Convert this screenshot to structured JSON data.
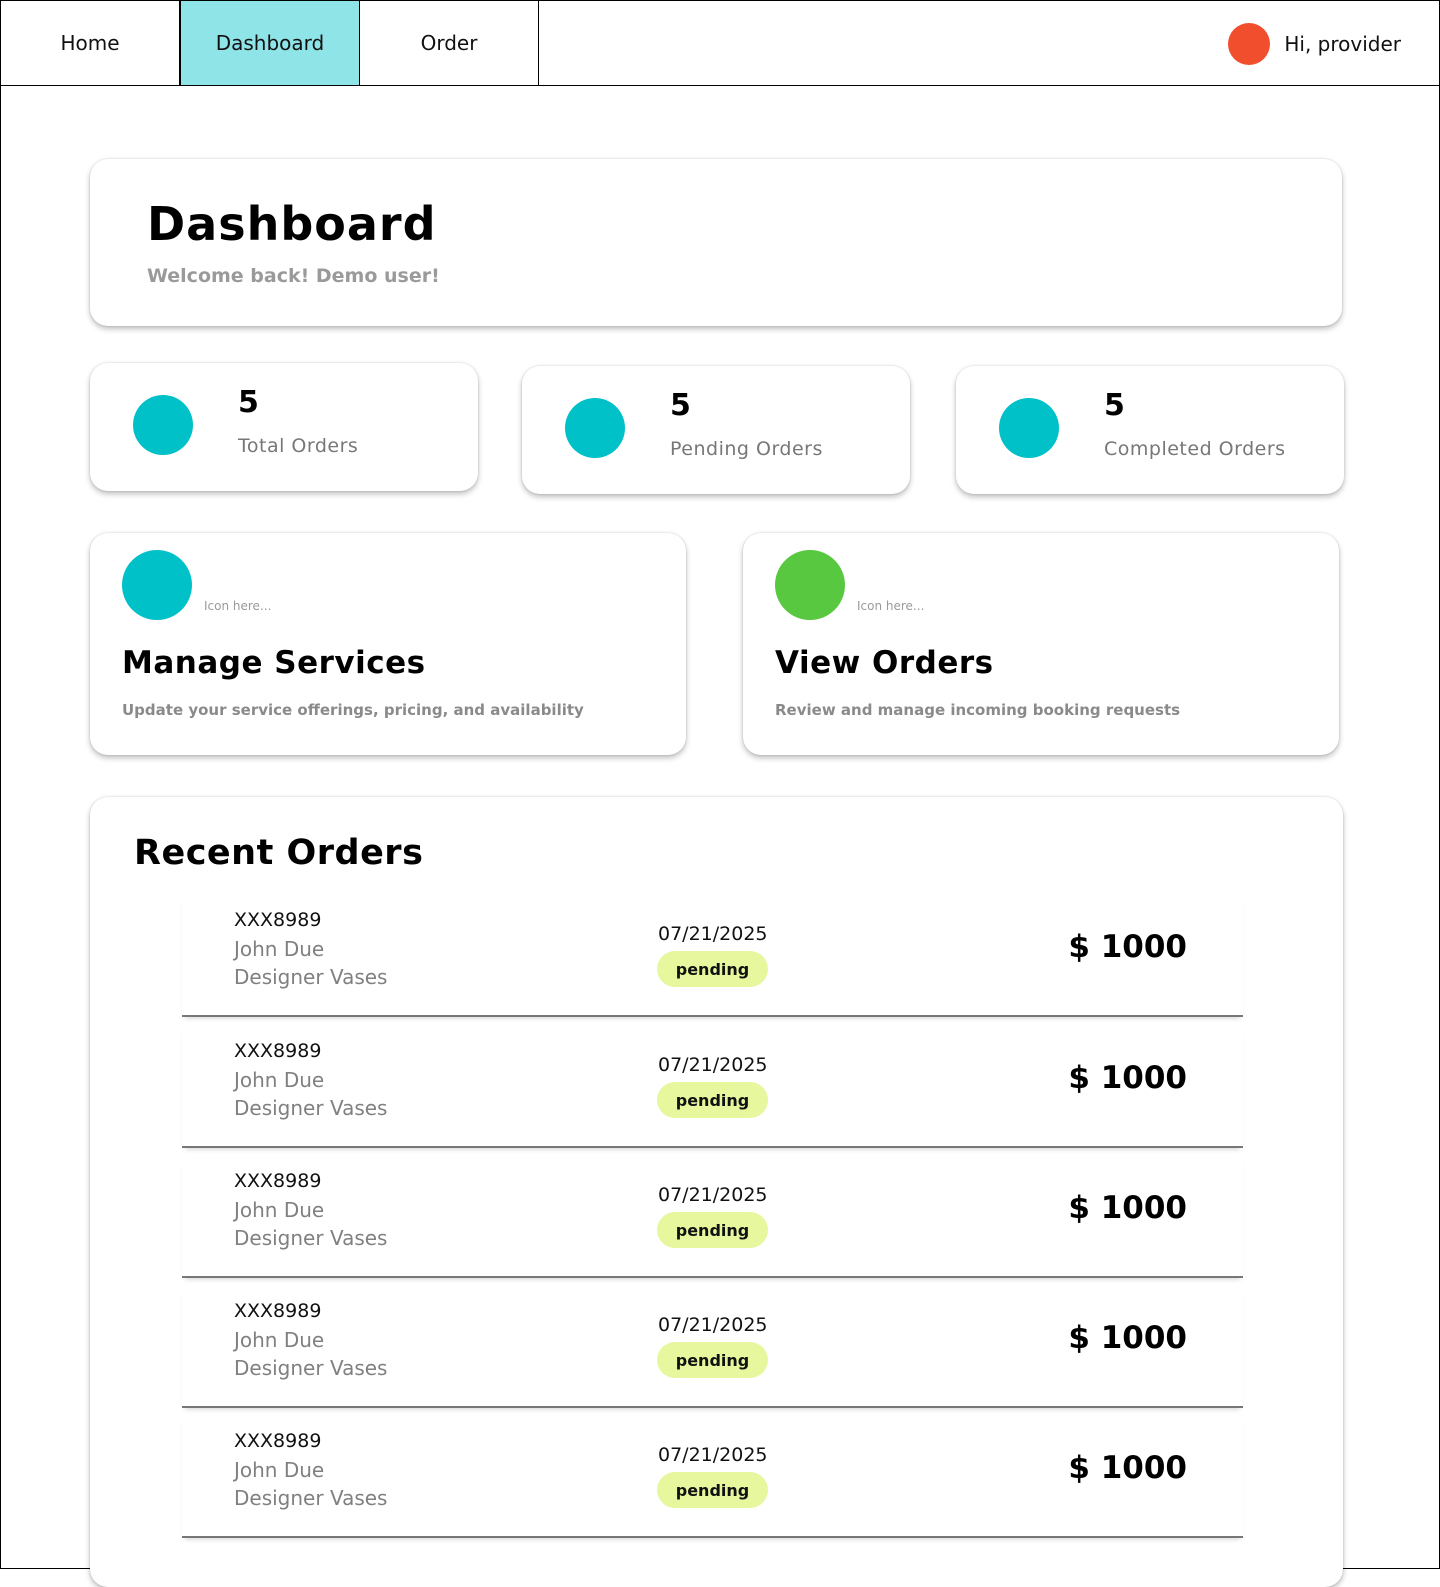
{
  "nav": {
    "tabs": [
      {
        "label": "Home"
      },
      {
        "label": "Dashboard",
        "active": true
      },
      {
        "label": "Order"
      }
    ],
    "user_greeting": "Hi, provider",
    "avatar_color": "#f04e2d"
  },
  "header": {
    "title": "Dashboard",
    "subtitle": "Welcome back! Demo user!"
  },
  "stats": [
    {
      "value": "5",
      "label": "Total Orders",
      "icon_color": "#00c0c8"
    },
    {
      "value": "5",
      "label": "Pending Orders",
      "icon_color": "#00c0c8"
    },
    {
      "value": "5",
      "label": "Completed Orders",
      "icon_color": "#00c0c8"
    }
  ],
  "actions": [
    {
      "hint": "Icon here...",
      "title": "Manage Services",
      "description": "Update your service offerings, pricing, and availability",
      "icon_color": "#00c0c8"
    },
    {
      "hint": "Icon here...",
      "title": "View Orders",
      "description": "Review and manage incoming booking requests",
      "icon_color": "#58c840"
    }
  ],
  "recent_orders": {
    "title": "Recent Orders",
    "rows": [
      {
        "id": "XXX8989",
        "customer": "John Due",
        "item": "Designer Vases",
        "date": "07/21/2025",
        "status": "pending",
        "amount": "$ 1000"
      },
      {
        "id": "XXX8989",
        "customer": "John Due",
        "item": "Designer Vases",
        "date": "07/21/2025",
        "status": "pending",
        "amount": "$ 1000"
      },
      {
        "id": "XXX8989",
        "customer": "John Due",
        "item": "Designer Vases",
        "date": "07/21/2025",
        "status": "pending",
        "amount": "$ 1000"
      },
      {
        "id": "XXX8989",
        "customer": "John Due",
        "item": "Designer Vases",
        "date": "07/21/2025",
        "status": "pending",
        "amount": "$ 1000"
      },
      {
        "id": "XXX8989",
        "customer": "John Due",
        "item": "Designer Vases",
        "date": "07/21/2025",
        "status": "pending",
        "amount": "$ 1000"
      }
    ]
  }
}
